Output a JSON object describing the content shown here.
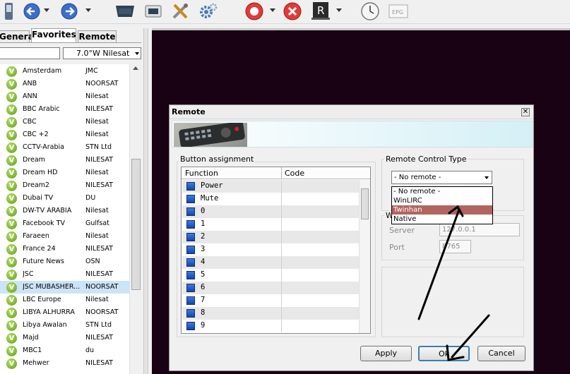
{
  "toolbar": {
    "icons": [
      "phone-icon",
      "back-icon",
      "forward-icon",
      "tv-tray-icon",
      "monitor-icon",
      "tools-icon",
      "gear-icon",
      "record-icon",
      "stop-icon",
      "remote-r-icon",
      "clock-icon",
      "epg-icon"
    ],
    "epg_label": "EPG",
    "r_label": "R"
  },
  "left": {
    "tabs": [
      "General",
      "Favorites",
      "Remote"
    ],
    "active_tab": "Favorites",
    "search_value": "",
    "satellite": "7.0°W Nilesat",
    "channels": [
      {
        "name": "Amsterdam",
        "sat": "JMC"
      },
      {
        "name": "ANB",
        "sat": "NOORSAT"
      },
      {
        "name": "ANN",
        "sat": "Nilesat"
      },
      {
        "name": "BBC Arabic",
        "sat": "NILESAT"
      },
      {
        "name": "CBC",
        "sat": "Nilesat"
      },
      {
        "name": "CBC +2",
        "sat": "Nilesat"
      },
      {
        "name": "CCTV-Arabia",
        "sat": "STN Ltd"
      },
      {
        "name": "Dream",
        "sat": "NILESAT"
      },
      {
        "name": "Dream HD",
        "sat": "Nilesat"
      },
      {
        "name": "Dream2",
        "sat": "NILESAT"
      },
      {
        "name": "Dubai TV",
        "sat": "DU"
      },
      {
        "name": "DW-TV ARABIA",
        "sat": "Nilesat"
      },
      {
        "name": "Facebook TV",
        "sat": "Gulfsat"
      },
      {
        "name": "Faraeen",
        "sat": "Nilesat"
      },
      {
        "name": "France 24",
        "sat": "NILESAT"
      },
      {
        "name": "Future News",
        "sat": "OSN"
      },
      {
        "name": "JSC",
        "sat": "NILESAT"
      },
      {
        "name": "JSC MUBASHER...",
        "sat": "NOORSAT"
      },
      {
        "name": "LBC Europe",
        "sat": "Nilesat"
      },
      {
        "name": "LIBYA ALHURRA",
        "sat": "NOORSAT"
      },
      {
        "name": "Libya Awalan",
        "sat": "STN Ltd"
      },
      {
        "name": "Majd",
        "sat": "NILESAT"
      },
      {
        "name": "MBC1",
        "sat": "du"
      },
      {
        "name": "Mehwer",
        "sat": "NILESAT"
      }
    ],
    "selected_channel": "JSC MUBASHER..."
  },
  "dialog": {
    "title": "Remote",
    "close_glyph": "✕",
    "button_assignment": {
      "label": "Button assignment",
      "col_function": "Function",
      "col_code": "Code",
      "rows": [
        "Power",
        "Mute",
        "0",
        "1",
        "2",
        "3",
        "4",
        "5",
        "6",
        "7",
        "8",
        "9"
      ]
    },
    "remote_type": {
      "label": "Remote Control Type",
      "selected": "- No remote -",
      "options": [
        "- No remote -",
        "WinLIRC",
        "Twinhan",
        "Native"
      ],
      "highlighted": "Twinhan"
    },
    "winlirc": {
      "label": "W",
      "server_label": "Server",
      "server_value": "127.0.0.1",
      "port_label": "Port",
      "port_value": "8765"
    },
    "buttons": {
      "apply": "Apply",
      "ok": "Ok",
      "cancel": "Cancel"
    }
  },
  "colors": {
    "dark_area": "#180214",
    "highlight": "#b06560",
    "selected_row": "#cce4f7",
    "channel_icon": "#6aaa1f"
  }
}
